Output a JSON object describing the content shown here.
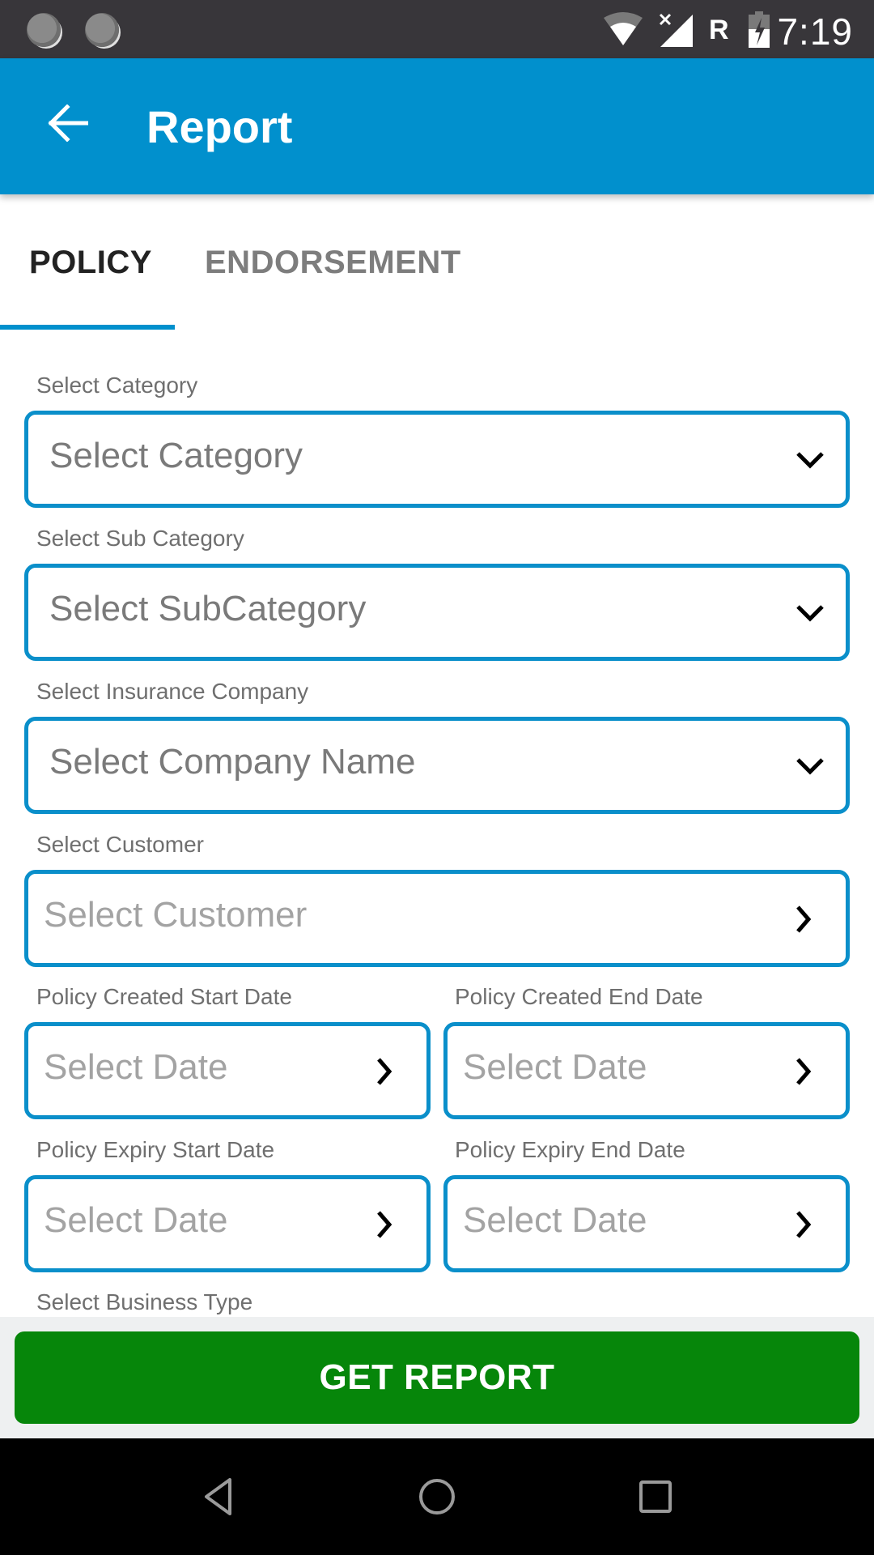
{
  "status_bar": {
    "time": "7:19",
    "roaming_indicator": "R",
    "icons": [
      "notification-dot-icon",
      "notification-dot-icon",
      "wifi-icon",
      "no-signal-icon",
      "battery-charging-icon"
    ]
  },
  "app_bar": {
    "title": "Report",
    "back_icon": "arrow-left-icon"
  },
  "tabs": [
    {
      "label": "POLICY",
      "active": true
    },
    {
      "label": "ENDORSEMENT",
      "active": false
    }
  ],
  "colors": {
    "primary": "#0190cd",
    "button_green": "#06860a",
    "status_bar": "#38363a"
  },
  "form": {
    "category": {
      "label": "Select Category",
      "value": "Select Category",
      "icon": "chevron-down-icon"
    },
    "sub_category": {
      "label": "Select Sub Category",
      "value": "Select SubCategory",
      "icon": "chevron-down-icon"
    },
    "insurance_company": {
      "label": "Select Insurance Company",
      "value": "Select Company Name",
      "icon": "chevron-down-icon"
    },
    "customer": {
      "label": "Select Customer",
      "placeholder": "Select Customer",
      "icon": "chevron-right-icon"
    },
    "policy_created_start": {
      "label": "Policy Created Start Date",
      "placeholder": "Select Date",
      "icon": "chevron-right-icon"
    },
    "policy_created_end": {
      "label": "Policy Created End Date",
      "placeholder": "Select Date",
      "icon": "chevron-right-icon"
    },
    "policy_expiry_start": {
      "label": "Policy Expiry Start Date",
      "placeholder": "Select Date",
      "icon": "chevron-right-icon"
    },
    "policy_expiry_end": {
      "label": "Policy Expiry End Date",
      "placeholder": "Select Date",
      "icon": "chevron-right-icon"
    },
    "business_type": {
      "label": "Select Business Type"
    }
  },
  "actions": {
    "get_report_label": "GET REPORT"
  },
  "nav_bar": {
    "buttons": [
      "back",
      "home",
      "recents"
    ]
  }
}
